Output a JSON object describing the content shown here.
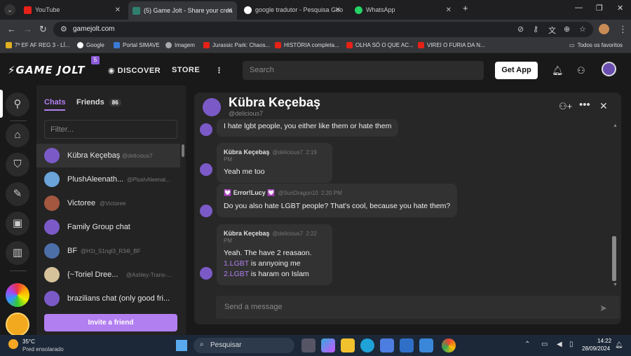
{
  "browser": {
    "tabs": [
      {
        "title": "YouTube"
      },
      {
        "title": "(5) Game Jolt - Share your crea"
      },
      {
        "title": "google tradutor - Pesquisa Goo"
      },
      {
        "title": "WhatsApp"
      }
    ],
    "url": "gamejolt.com",
    "bookmarks": [
      "7º EF AF REG 3 - LÍ...",
      "Google",
      "Portal SIMAVE",
      "Imagem",
      "Jurassic Park: Chaos...",
      "HISTÓRIA completa...",
      "OLHA SÓ O QUE AC...",
      "VIREI O FURIA DA N...",
      "Todos os favoritos"
    ]
  },
  "gj": {
    "logo": "GAME JOLT",
    "badge": "5",
    "nav_discover": "DISCOVER",
    "nav_store": "STORE",
    "search_placeholder": "Search",
    "get_app": "Get App"
  },
  "chats": {
    "tab_chats": "Chats",
    "tab_friends": "Friends",
    "friends_count": "86",
    "filter_placeholder": "Filter...",
    "list": [
      {
        "name": "Kübra Keçebaş",
        "handle": "@delicious7"
      },
      {
        "name": "PlushAleenath...",
        "handle": "@PlushAleenat..."
      },
      {
        "name": "Victoree",
        "handle": "@Victoree"
      },
      {
        "name": "Family Group chat",
        "handle": ""
      },
      {
        "name": "BF",
        "handle": "@H1t_S1ngl3_R34l_BF"
      },
      {
        "name": "{~Toriel Dree...",
        "handle": "@Ashley-Trans-..."
      },
      {
        "name": "brazilians chat (only good fri...",
        "handle": ""
      }
    ],
    "invite": "Invite a friend"
  },
  "room": {
    "title": "Kübra Keçebaş",
    "handle": "@delicious7",
    "messages": [
      {
        "text": "I hate lgbt people, you either like them or hate them"
      },
      {
        "author": "Kübra Keçebaş",
        "handle": "@delicious7",
        "time": "2:19 PM",
        "text": "Yeah me too"
      },
      {
        "author": "💟 Error!Lucy 💟",
        "handle": "@SunDragon10",
        "time": "2:20 PM",
        "text": "Do you also hate LGBT people? That's cool, because you hate them?"
      },
      {
        "author": "Kübra Keçebaş",
        "handle": "@delicious7",
        "time": "2:22 PM",
        "line1": "Yeah. The have 2 reasaon.",
        "l2num": "1.LGBT",
        "l2rest": " is annyoing me",
        "l3num": "2.LGBT",
        "l3rest": " is haram on Islam"
      }
    ],
    "send_placeholder": "Send a message"
  },
  "taskbar": {
    "weather_temp": "35°C",
    "weather_desc": "Pred ensolarado",
    "search": "Pesquisar",
    "time": "14:22",
    "date": "28/09/2024"
  },
  "colors": {
    "accent": "#b27ff0",
    "bg": "#191919"
  }
}
